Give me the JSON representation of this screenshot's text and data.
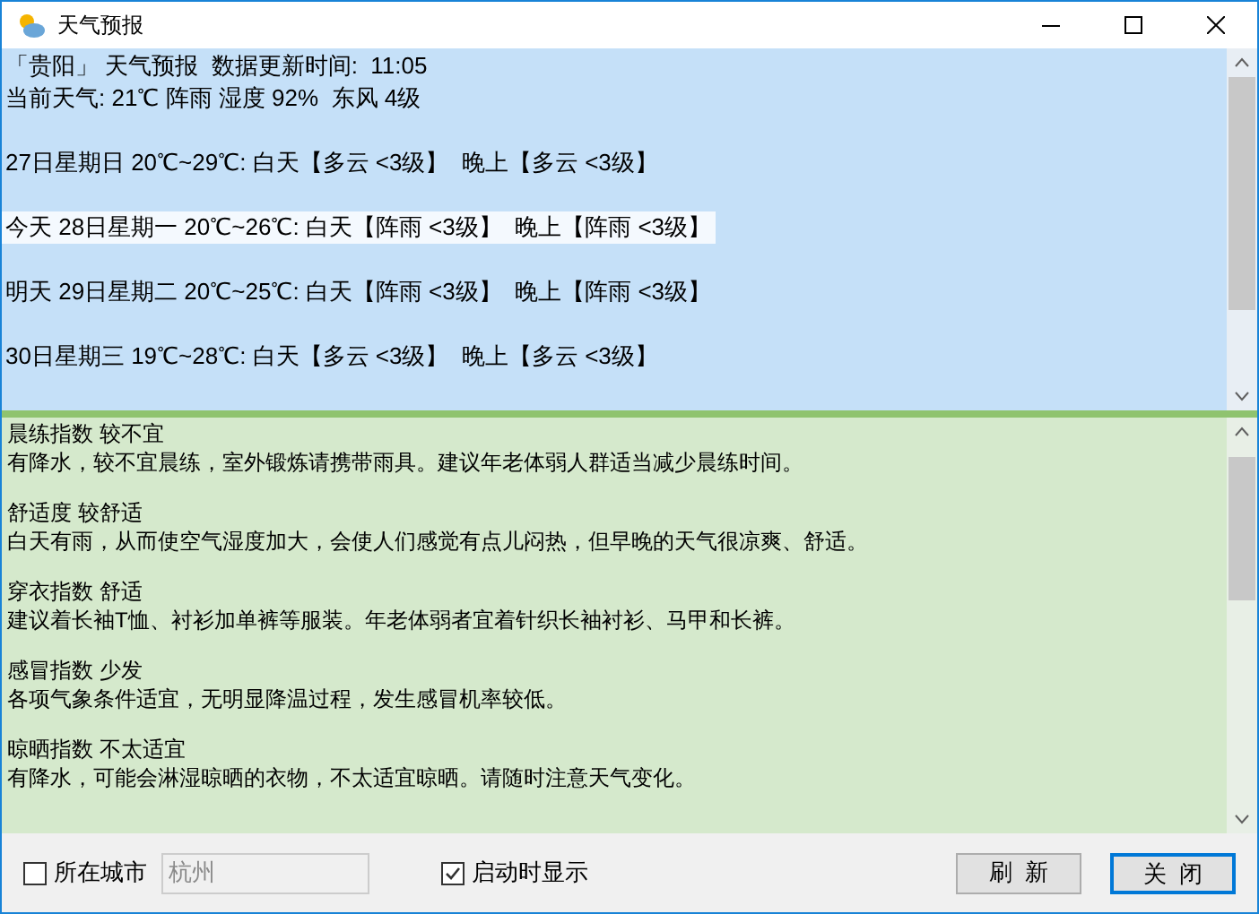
{
  "window": {
    "title": "天气预报"
  },
  "forecast_pane": {
    "header": [
      "「贵阳」 天气预报  数据更新时间:  11:05",
      "当前天气: 21℃ 阵雨 湿度 92%  东风 4级"
    ],
    "days": [
      {
        "text": "27日星期日 20℃~29℃: 白天【多云 <3级】  晚上【多云 <3级】",
        "selected": false
      },
      {
        "text": "今天 28日星期一 20℃~26℃: 白天【阵雨 <3级】  晚上【阵雨 <3级】",
        "selected": true
      },
      {
        "text": "明天 29日星期二 20℃~25℃: 白天【阵雨 <3级】  晚上【阵雨 <3级】",
        "selected": false
      },
      {
        "text": "30日星期三 19℃~28℃: 白天【多云 <3级】  晚上【多云 <3级】",
        "selected": false
      }
    ]
  },
  "indices_pane": {
    "items": [
      {
        "title": "晨练指数 较不宜",
        "description": "有降水，较不宜晨练，室外锻炼请携带雨具。建议年老体弱人群适当减少晨练时间。"
      },
      {
        "title": "舒适度 较舒适",
        "description": "白天有雨，从而使空气湿度加大，会使人们感觉有点儿闷热，但早晚的天气很凉爽、舒适。"
      },
      {
        "title": "穿衣指数 舒适",
        "description": "建议着长袖T恤、衬衫加单裤等服装。年老体弱者宜着针织长袖衬衫、马甲和长裤。"
      },
      {
        "title": "感冒指数 少发",
        "description": "各项气象条件适宜，无明显降温过程，发生感冒机率较低。"
      },
      {
        "title": "晾晒指数 不太适宜",
        "description": "有降水，可能会淋湿晾晒的衣物，不太适宜晾晒。请随时注意天气变化。"
      }
    ]
  },
  "footer": {
    "city_checkbox": {
      "label": "所在城市",
      "checked": false
    },
    "city_field": {
      "value": "杭州",
      "disabled": true
    },
    "startup_checkbox": {
      "label": "启动时显示",
      "checked": true
    },
    "buttons": [
      {
        "label": "刷  新",
        "default": false
      },
      {
        "label": "关  闭",
        "default": true
      }
    ]
  }
}
